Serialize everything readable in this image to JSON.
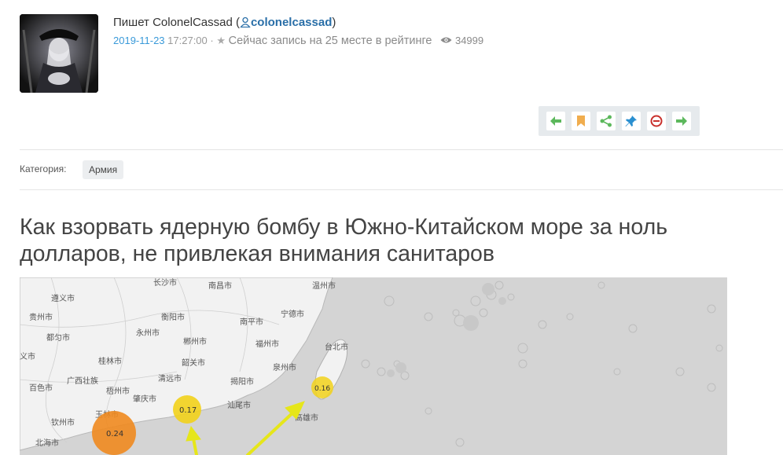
{
  "author": {
    "prefix": "Пишет ColonelCassad (",
    "username": "colonelcassad",
    "suffix": ")"
  },
  "meta": {
    "date": "2019-11-23",
    "time": " 17:27:00",
    "separator": " · ",
    "rating": "Сейчас запись на 25 месте в рейтинге",
    "views": "34999"
  },
  "toolbar": {
    "icons": [
      "arrow-left-icon",
      "bookmark-icon",
      "share-icon",
      "pin-icon",
      "block-icon",
      "arrow-right-icon"
    ],
    "colors": {
      "green": "#5cb85c",
      "orange": "#f0ad4e",
      "blue": "#2a8fd0",
      "red": "#c9302c"
    }
  },
  "category": {
    "label": "Категория:",
    "tag": "Армия"
  },
  "post": {
    "title": "Как взорвать ядерную бомбу в Южно-Китайском море за ноль долларов, не привлекая внимания санитаров"
  },
  "map": {
    "cities": [
      "长沙市",
      "南昌市",
      "温州市",
      "遵义市",
      "贵州市",
      "衡阳市",
      "南平市",
      "宁德市",
      "都匀市",
      "永州市",
      "郴州市",
      "福州市",
      "台北市",
      "义市",
      "桂林市",
      "韶关市",
      "泉州市",
      "清远市",
      "揭阳市",
      "百色市",
      "广西壮族",
      "梧州市",
      "肇庆市",
      "汕尾市",
      "高雄市",
      "钦州市",
      "北海市",
      "玉林市"
    ],
    "markers": [
      {
        "label": "0.17",
        "color": "#f2d21b"
      },
      {
        "label": "0.24",
        "color": "#ef8a1f"
      },
      {
        "label": "0.16",
        "color": "#f2d21b"
      }
    ]
  }
}
